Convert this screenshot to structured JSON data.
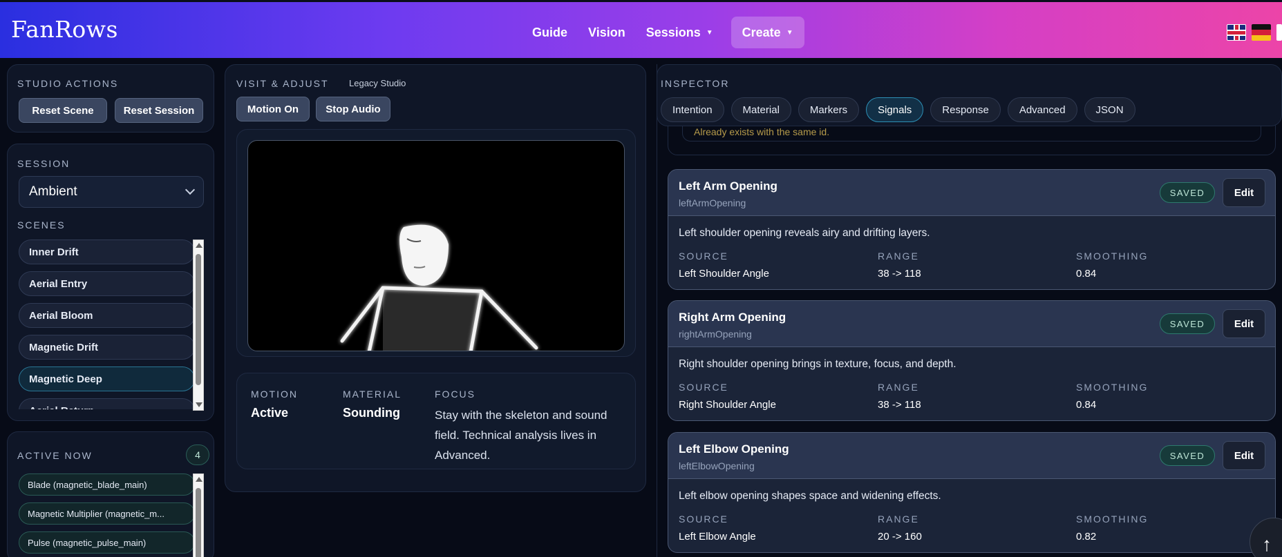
{
  "header": {
    "brand": "FanRows",
    "nav": [
      "Guide",
      "Vision",
      "Sessions",
      "Create"
    ]
  },
  "studio": {
    "title": "STUDIO ACTIONS",
    "reset_scene": "Reset Scene",
    "reset_session": "Reset Session"
  },
  "session": {
    "title": "SESSION",
    "selected": "Ambient",
    "scenes_title": "SCENES",
    "scenes": [
      "Inner Drift",
      "Aerial Entry",
      "Aerial Bloom",
      "Magnetic Drift",
      "Magnetic Deep",
      "Aerial Return"
    ],
    "active_scene_index": 4
  },
  "active_now": {
    "title": "ACTIVE NOW",
    "count": "4",
    "items": [
      "Blade (magnetic_blade_main)",
      "Magnetic Multiplier (magnetic_m...",
      "Pulse (magnetic_pulse_main)"
    ]
  },
  "visit": {
    "title": "VISIT & ADJUST",
    "subtitle": "Legacy Studio",
    "motion_btn": "Motion On",
    "audio_btn": "Stop Audio",
    "motion_label": "MOTION",
    "motion_value": "Active",
    "material_label": "MATERIAL",
    "material_value": "Sounding",
    "focus_label": "FOCUS",
    "focus_value": "Stay with the skeleton and sound field. Technical analysis lives in Advanced."
  },
  "inspector": {
    "title": "INSPECTOR",
    "tabs": [
      "Intention",
      "Material",
      "Markers",
      "Signals",
      "Response",
      "Advanced",
      "JSON"
    ],
    "active_tab_index": 3,
    "hidden_note": "Already exists with the same id.",
    "col_source": "SOURCE",
    "col_range": "RANGE",
    "col_smoothing": "SMOOTHING",
    "saved_label": "SAVED",
    "edit_label": "Edit",
    "signals": [
      {
        "title": "Left Arm Opening",
        "key": "leftArmOpening",
        "desc": "Left shoulder opening reveals airy and drifting layers.",
        "source": "Left Shoulder Angle",
        "range": "38 -> 118",
        "smoothing": "0.84"
      },
      {
        "title": "Right Arm Opening",
        "key": "rightArmOpening",
        "desc": "Right shoulder opening brings in texture, focus, and depth.",
        "source": "Right Shoulder Angle",
        "range": "38 -> 118",
        "smoothing": "0.84"
      },
      {
        "title": "Left Elbow Opening",
        "key": "leftElbowOpening",
        "desc": "Left elbow opening shapes space and widening effects.",
        "source": "Left Elbow Angle",
        "range": "20 -> 160",
        "smoothing": "0.82"
      }
    ]
  },
  "colors": {
    "accent_gradient_start": "#2a2fe0",
    "accent_gradient_end": "#ec44a8",
    "saved_green": "#2e7a6e",
    "tab_active": "#2d8fb5"
  }
}
